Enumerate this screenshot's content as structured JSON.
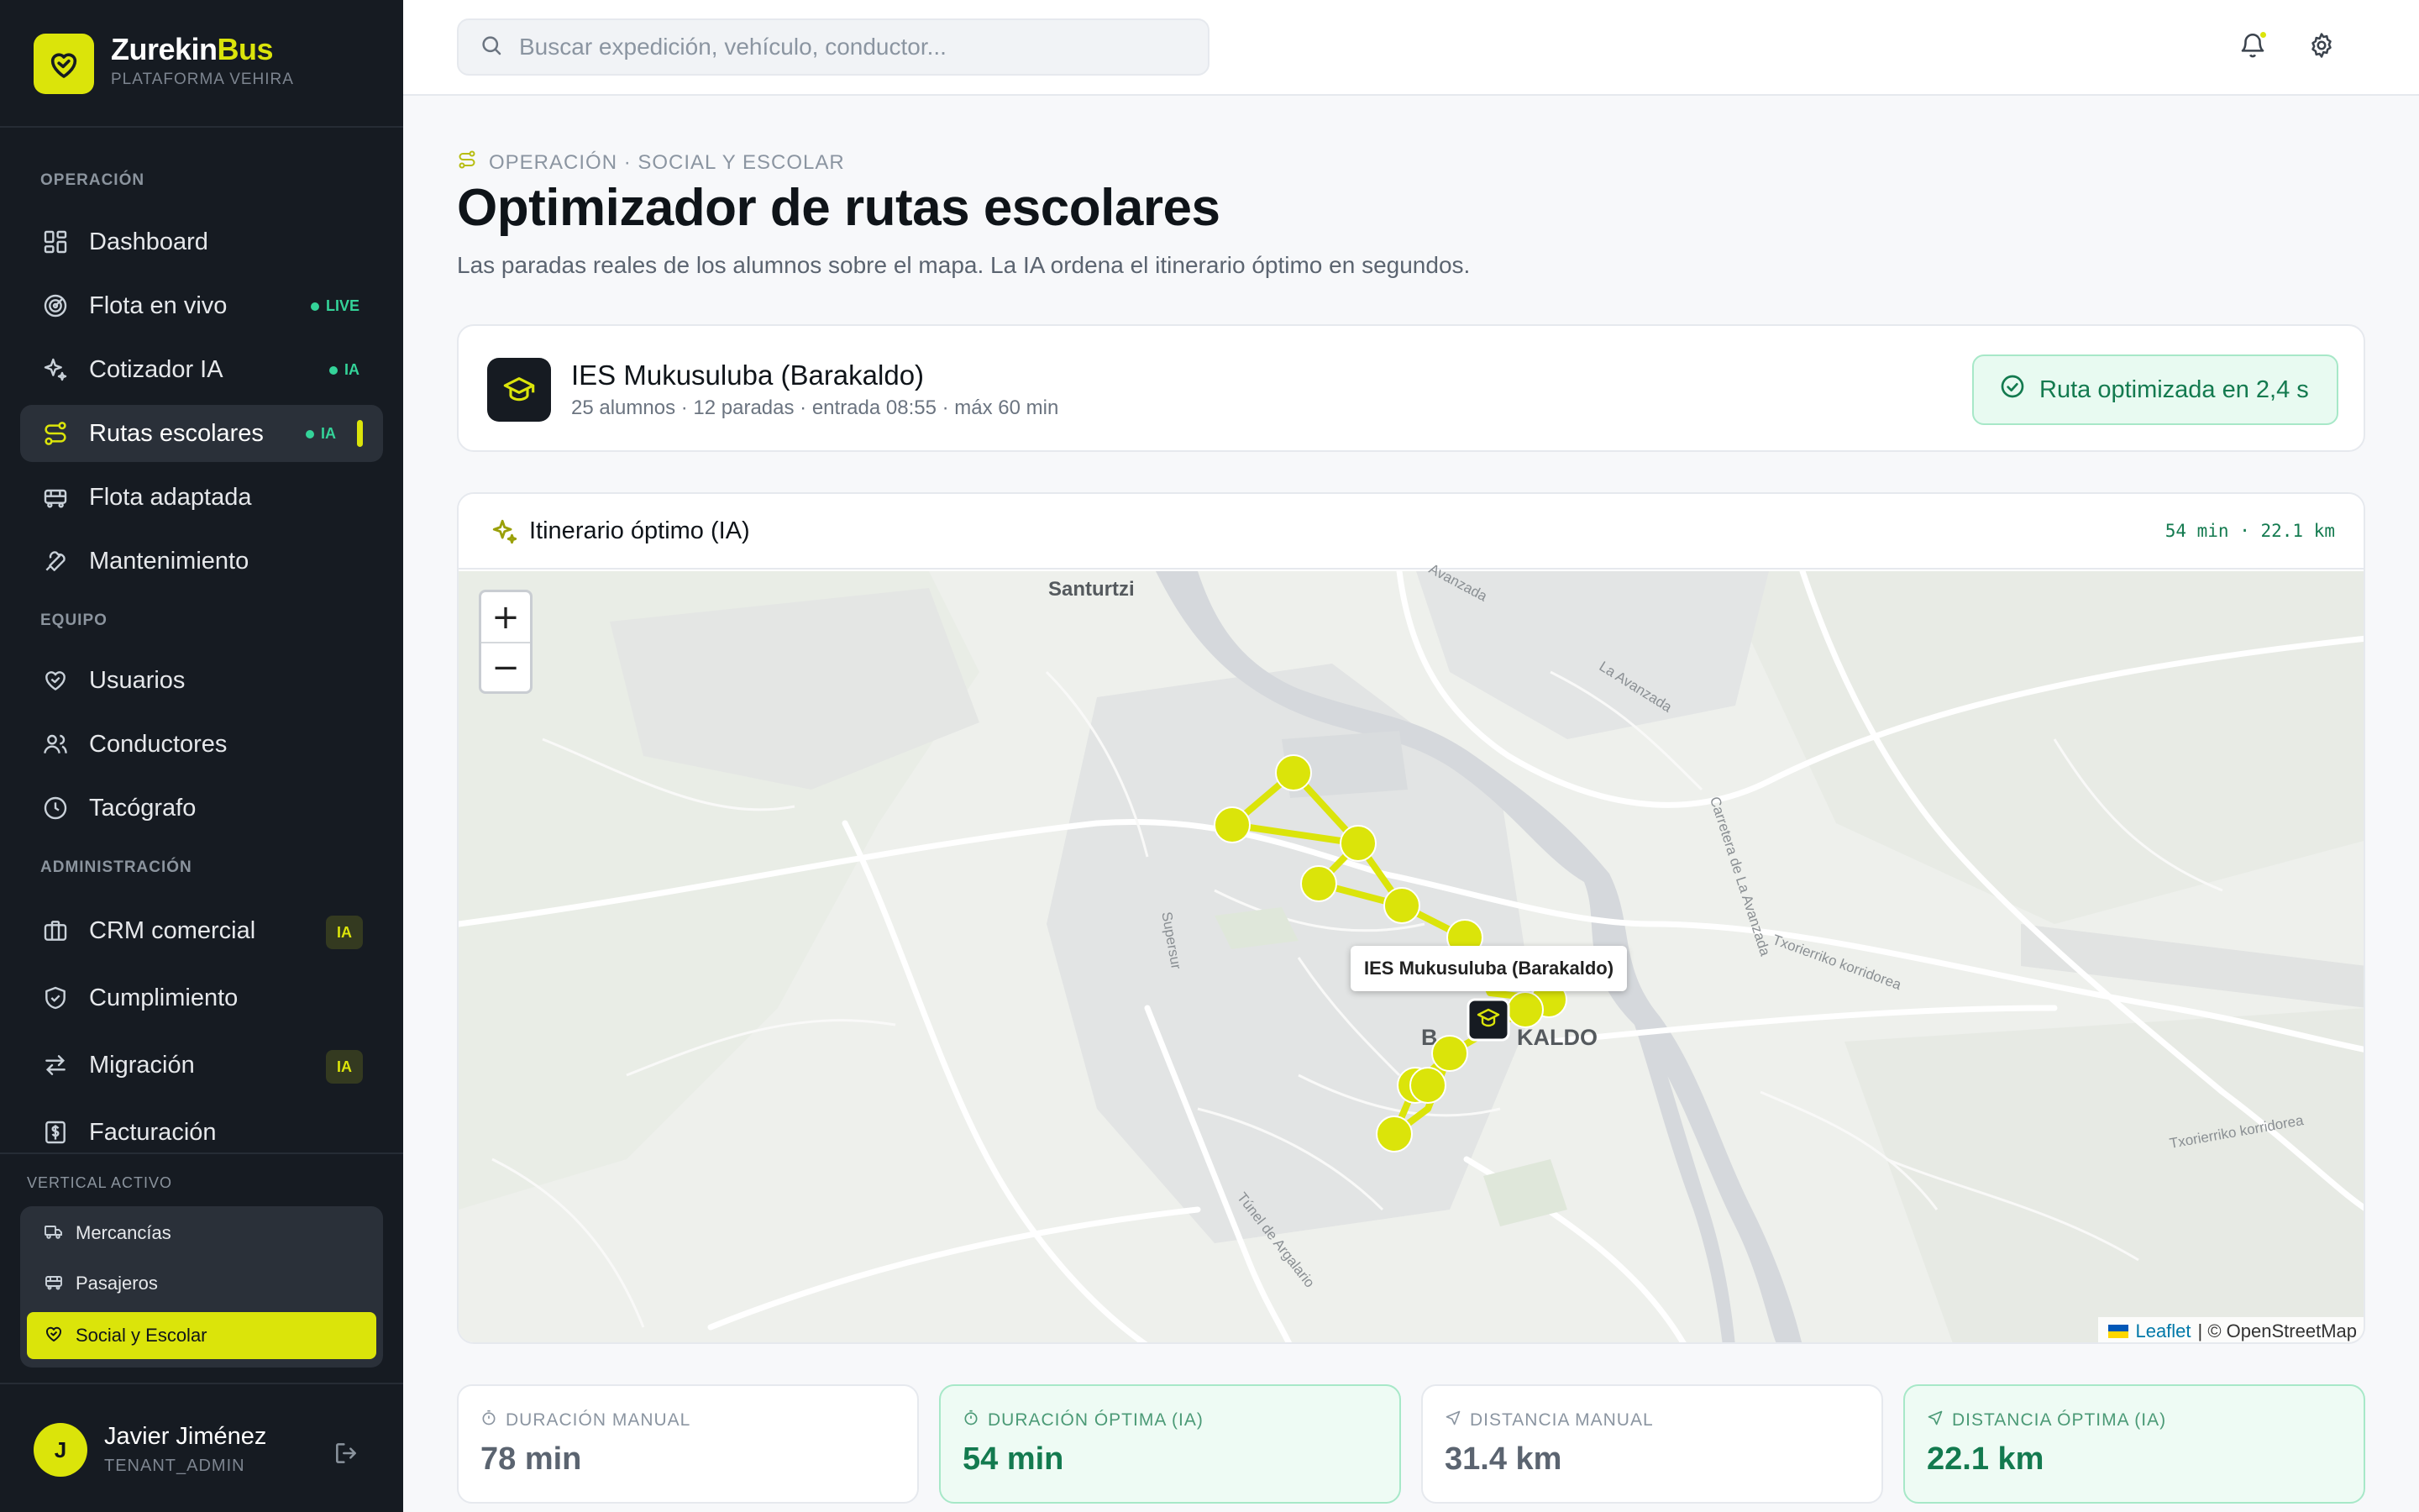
{
  "brand": {
    "name_part1": "Zurekin",
    "name_part2": "Bus",
    "subtitle": "PLATAFORMA VEHIRA"
  },
  "nav": {
    "section_operacion": "OPERACIÓN",
    "section_equipo": "EQUIPO",
    "section_admin": "ADMINISTRACIÓN",
    "items": [
      {
        "label": "Dashboard",
        "icon": "grid-icon"
      },
      {
        "label": "Flota en vivo",
        "icon": "radar-icon",
        "tag": "LIVE"
      },
      {
        "label": "Cotizador IA",
        "icon": "sparkles-icon",
        "tag": "IA"
      },
      {
        "label": "Rutas escolares",
        "icon": "route-icon",
        "tag": "IA",
        "active": true
      },
      {
        "label": "Flota adaptada",
        "icon": "bus-icon"
      },
      {
        "label": "Mantenimiento",
        "icon": "wrench-icon"
      },
      {
        "label": "Usuarios",
        "icon": "heart-hand-icon"
      },
      {
        "label": "Conductores",
        "icon": "users-icon"
      },
      {
        "label": "Tacógrafo",
        "icon": "clock-icon"
      },
      {
        "label": "CRM comercial",
        "icon": "briefcase-icon",
        "tag": "IA"
      },
      {
        "label": "Cumplimiento",
        "icon": "shield-icon"
      },
      {
        "label": "Migración",
        "icon": "arrows-icon",
        "tag": "IA"
      },
      {
        "label": "Facturación",
        "icon": "receipt-icon"
      }
    ]
  },
  "vertical": {
    "title": "VERTICAL ACTIVO",
    "items": [
      {
        "label": "Mercancías",
        "icon": "truck-icon"
      },
      {
        "label": "Pasajeros",
        "icon": "bus-icon"
      },
      {
        "label": "Social y Escolar",
        "icon": "heart-hand-icon",
        "selected": true
      }
    ]
  },
  "user": {
    "initial": "J",
    "name": "Javier Jiménez",
    "role": "TENANT_ADMIN"
  },
  "search": {
    "placeholder": "Buscar expedición, vehículo, conductor..."
  },
  "page": {
    "breadcrumb": "OPERACIÓN · SOCIAL Y ESCOLAR",
    "title": "Optimizador de rutas escolares",
    "subtitle": "Las paradas reales de los alumnos sobre el mapa. La IA ordena el itinerario óptimo en segundos."
  },
  "school": {
    "name": "IES Mukusuluba (Barakaldo)",
    "meta": "25 alumnos · 12 paradas · entrada 08:55 · máx 60 min",
    "badge": "Ruta optimizada en 2,4 s"
  },
  "map": {
    "title": "Itinerario óptimo (IA)",
    "stats": "54 min · 22.1 km",
    "tooltip": "IES Mukusuluba (Barakaldo)",
    "zoom_in": "+",
    "zoom_out": "−",
    "attribution_link": "Leaflet",
    "attribution_text": "| © OpenStreetMap",
    "place_santurtzi": "Santurtzi",
    "place_barakaldo_left": "B",
    "place_barakaldo_right": "KALDO",
    "street_1": "Avanzada",
    "street_2": "La Avanzada",
    "street_3": "Carretera de La Avanzada",
    "street_4": "Txorierriko korridorea",
    "street_5": "Txorierriko korridorea",
    "street_6": "Supersur",
    "street_7": "Túnel de Argalario",
    "route_color": "#dbe40a"
  },
  "kpis": [
    {
      "label": "DURACIÓN MANUAL",
      "value": "78 min",
      "highlight": false
    },
    {
      "label": "DURACIÓN ÓPTIMA (IA)",
      "value": "54 min",
      "highlight": true
    },
    {
      "label": "DISTANCIA MANUAL",
      "value": "31.4 km",
      "highlight": false
    },
    {
      "label": "DISTANCIA ÓPTIMA (IA)",
      "value": "22.1 km",
      "highlight": true
    }
  ],
  "colors": {
    "accent": "#dbe40a",
    "sidebar": "#161b22",
    "success": "#137a4f"
  }
}
